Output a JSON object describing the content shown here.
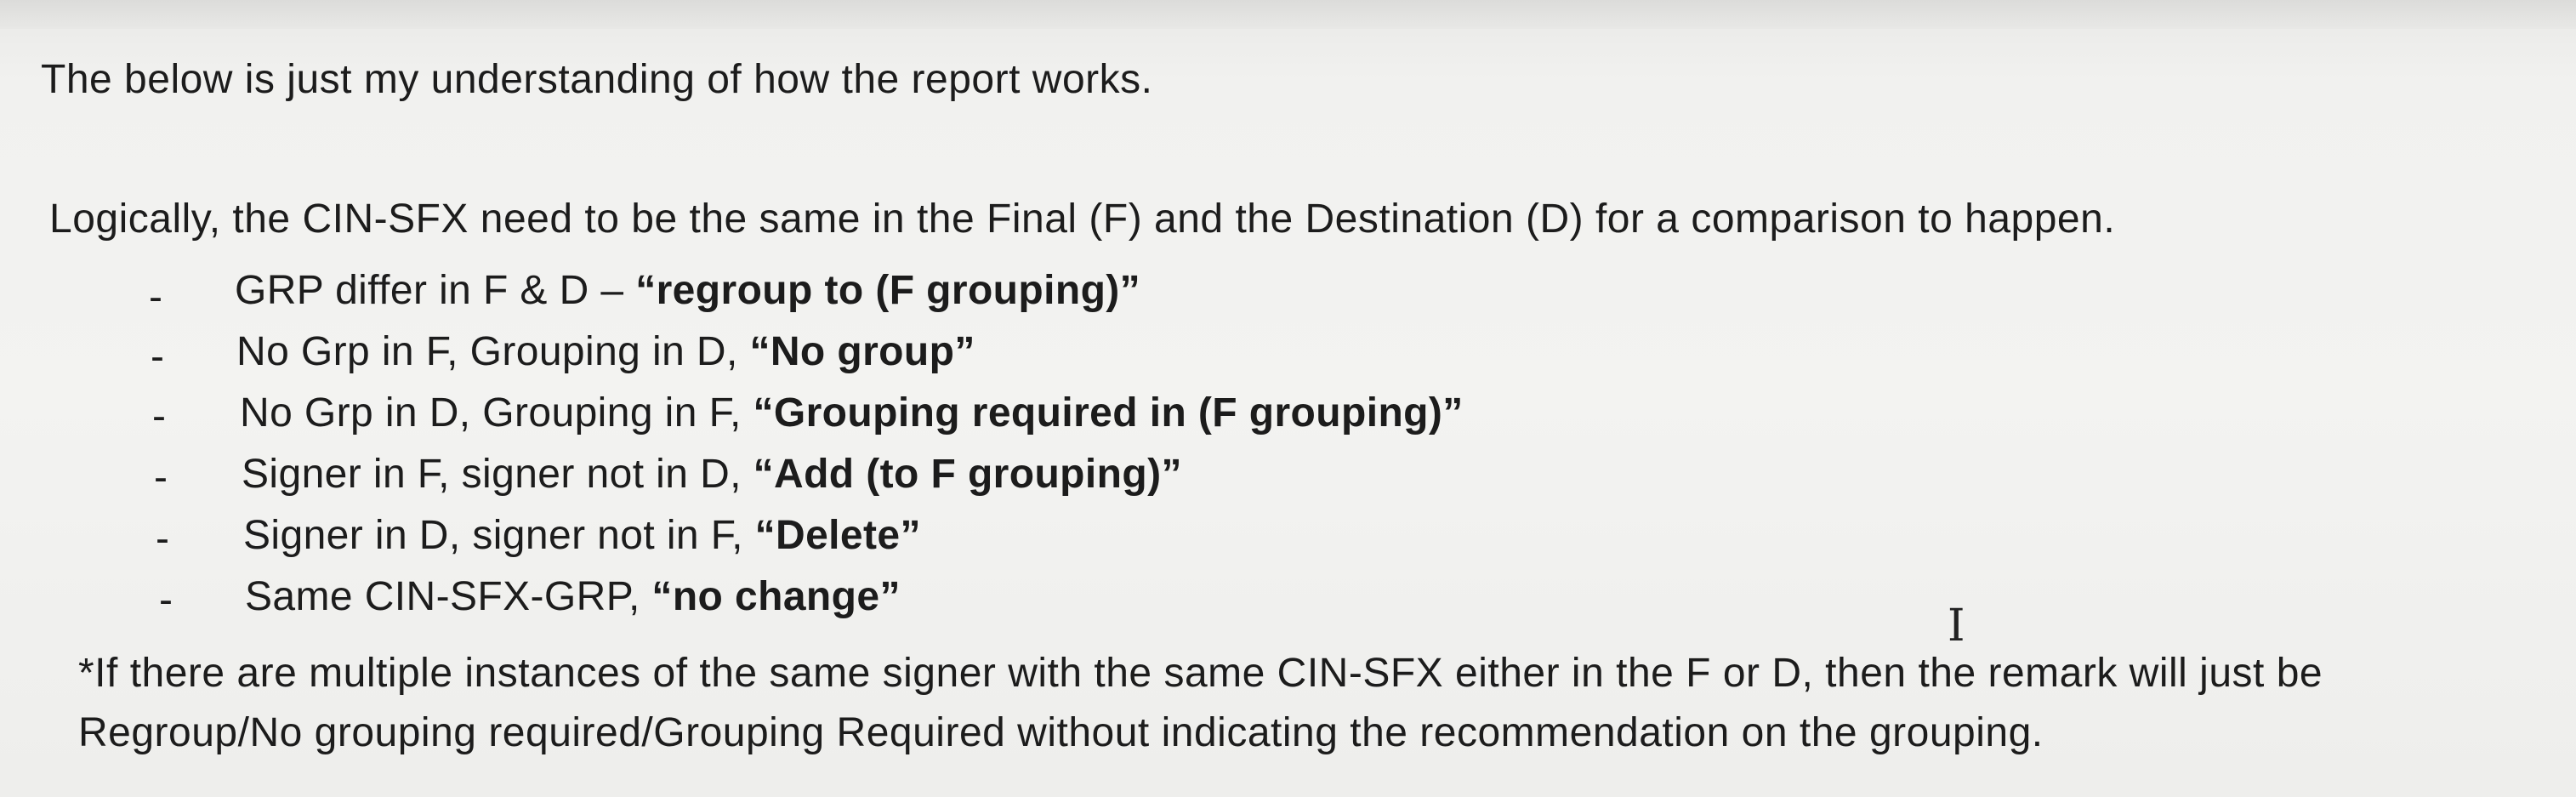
{
  "intro": "The below is just my understanding of how the report works.",
  "logic": "Logically, the CIN-SFX need to be the same in the Final (F) and the Destination (D) for a comparison to happen.",
  "bullets": [
    {
      "marker": "-",
      "text": "GRP differ in F & D – ",
      "bold": "“regroup to (F grouping)”"
    },
    {
      "marker": "-",
      "text": "No Grp in F, Grouping in D, ",
      "bold": "“No group”"
    },
    {
      "marker": "-",
      "text": "No Grp in D, Grouping in F, ",
      "bold": "“Grouping required in (F grouping)”"
    },
    {
      "marker": "-",
      "text": "Signer in F, signer not in D, ",
      "bold": "“Add (to F grouping)”"
    },
    {
      "marker": "-",
      "text": "Signer in D, signer not in F, ",
      "bold": "“Delete”"
    },
    {
      "marker": "-",
      "text": "Same CIN-SFX-GRP, ",
      "bold": "“no change”"
    }
  ],
  "note": {
    "line1": "*If there are multiple instances of the same signer with the same CIN-SFX either in the F or D, then the remark will just be",
    "line2": "Regroup/No grouping required/Grouping Required without indicating the recommendation on the grouping."
  },
  "cursor_glyph": "I"
}
